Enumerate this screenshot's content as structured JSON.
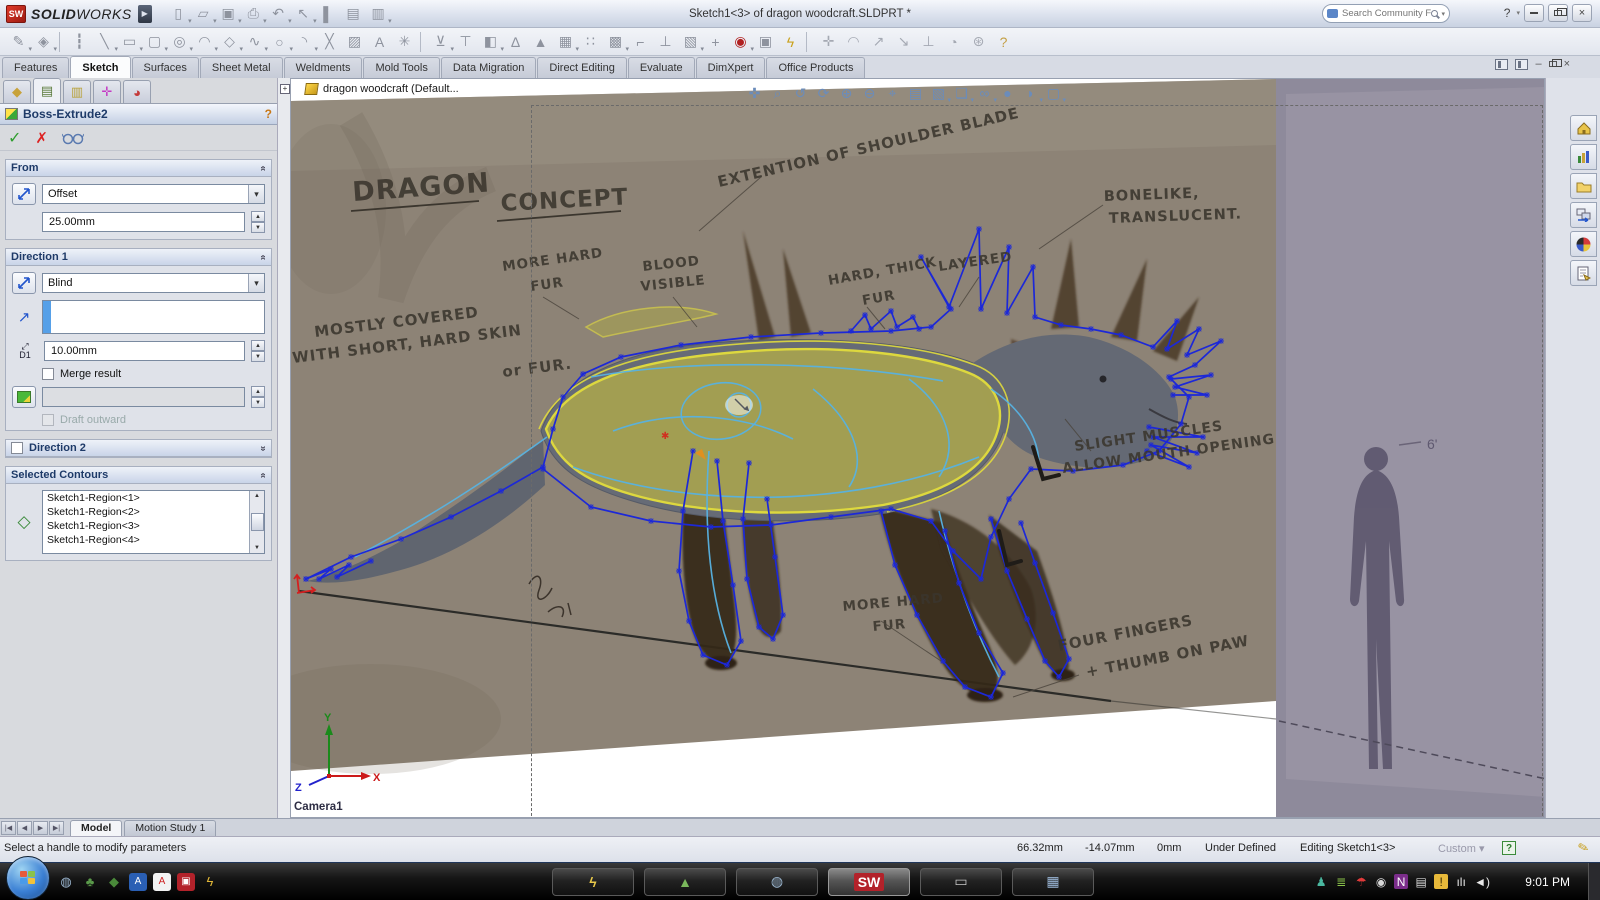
{
  "titlebar": {
    "brand_solid": "SOLID",
    "brand_works": "WORKS",
    "title": "Sketch1<3> of dragon woodcraft.SLDPRT *",
    "search_placeholder": "Search Community Forum",
    "help": "?"
  },
  "std_icons": [
    {
      "g": "▯",
      "dd": 1
    },
    {
      "g": "▱",
      "dd": 1
    },
    {
      "g": "▣",
      "dd": 1
    },
    {
      "g": "⎙",
      "dd": 1
    },
    {
      "g": "↶",
      "dd": 1
    },
    {
      "g": "↖",
      "dd": 1
    },
    {
      "g": "▌"
    },
    {
      "g": "▤"
    },
    {
      "g": "▥",
      "dd": 1
    }
  ],
  "sketch_icons": [
    {
      "g": "✎",
      "dd": 1
    },
    {
      "g": "◈",
      "dd": 1
    },
    {
      "sep": 1
    },
    {
      "g": "┇"
    },
    {
      "g": "╲",
      "dd": 1
    },
    {
      "g": "▭",
      "dd": 1
    },
    {
      "g": "▢",
      "dd": 1
    },
    {
      "g": "◎",
      "dd": 1
    },
    {
      "g": "◠",
      "dd": 1
    },
    {
      "g": "◇",
      "dd": 1
    },
    {
      "g": "∿",
      "dd": 1
    },
    {
      "g": "○",
      "dd": 1
    },
    {
      "g": "◝",
      "dd": 1
    },
    {
      "g": "╳"
    },
    {
      "g": "▨"
    },
    {
      "g": "A"
    },
    {
      "g": "✳"
    },
    {
      "sep": 1
    },
    {
      "g": "⊻",
      "dd": 1
    },
    {
      "g": "⊤"
    },
    {
      "g": "◧",
      "dd": 1
    },
    {
      "g": "∆"
    },
    {
      "g": "▲"
    },
    {
      "g": "▦",
      "dd": 1
    },
    {
      "g": "∷"
    },
    {
      "g": "▩",
      "dd": 1
    },
    {
      "g": "⌐"
    },
    {
      "g": "⊥"
    },
    {
      "g": "▧",
      "dd": 1
    },
    {
      "g": "+"
    },
    {
      "g": "◉",
      "c": "#b02020",
      "dd": 1
    },
    {
      "g": "▣"
    },
    {
      "g": "ϟ",
      "c": "#caa21e"
    }
  ],
  "snap_icons": [
    {
      "g": "✛"
    },
    {
      "g": "◠"
    },
    {
      "g": "↗"
    },
    {
      "g": "↘"
    },
    {
      "g": "⊥"
    },
    {
      "g": "◔"
    },
    {
      "g": "⊛"
    },
    {
      "g": "?",
      "c": "#b8860b"
    }
  ],
  "ribbon_tabs": [
    {
      "label": "Features"
    },
    {
      "label": "Sketch",
      "active": true
    },
    {
      "label": "Surfaces"
    },
    {
      "label": "Sheet Metal"
    },
    {
      "label": "Weldments"
    },
    {
      "label": "Mold Tools"
    },
    {
      "label": "Data Migration"
    },
    {
      "label": "Direct Editing"
    },
    {
      "label": "Evaluate"
    },
    {
      "label": "DimXpert"
    },
    {
      "label": "Office Products"
    }
  ],
  "pm_tabs": [
    {
      "g": "◆",
      "c": "#c8a23a"
    },
    {
      "g": "▤",
      "c": "#5a7a3a",
      "active": true
    },
    {
      "g": "▥",
      "c": "#b8a23a"
    },
    {
      "g": "✛",
      "c": "#c43ac4"
    },
    {
      "g": "◕",
      "c": "#c43a3a"
    }
  ],
  "pm": {
    "title": "Boss-Extrude2",
    "help": "?",
    "from": {
      "title": "From",
      "value": "Offset",
      "offset": "25.00mm"
    },
    "dir1": {
      "title": "Direction 1",
      "value": "Blind",
      "depth": "10.00mm",
      "d1": "D1",
      "merge_label": "Merge result",
      "draft_outward_label": "Draft outward"
    },
    "dir2": {
      "title": "Direction 2"
    },
    "contours": {
      "title": "Selected Contours",
      "items": [
        "Sketch1-Region<1>",
        "Sketch1-Region<2>",
        "Sketch1-Region<3>",
        "Sketch1-Region<4>"
      ]
    }
  },
  "viewport": {
    "doc": "dragon woodcraft  (Default...",
    "camera": "Camera1",
    "height_label": "6'",
    "hud": [
      {
        "g": "✜"
      },
      {
        "g": "⌕"
      },
      {
        "g": "↺"
      },
      {
        "g": "⟳"
      },
      {
        "g": "⊕"
      },
      {
        "g": "⊖"
      },
      {
        "g": "⌖"
      },
      {
        "g": "▤"
      },
      {
        "g": "▧",
        "dd": 1
      },
      {
        "g": "❏",
        "dd": 1
      },
      {
        "g": "∞",
        "dd": 1
      },
      {
        "g": "●"
      },
      {
        "g": "◗",
        "dd": 1
      },
      {
        "g": "▢",
        "dd": 1
      }
    ],
    "ann": {
      "t1": "DRAGON",
      "t2": "CONCEPT",
      "shoulder": "EXTENTION OF SHOULDER BLADE",
      "bone1": "BONELIKE,",
      "bone2": "TRANSLUCENT.",
      "fur1a": "MORE HARD",
      "fur1b": "FUR",
      "blood1": "BLOOD",
      "blood2": "VISIBLE",
      "hard1": "HARD, THICK",
      "hard2": "FUR",
      "layered": "LAYERED",
      "cover1": "MOSTLY COVERED",
      "cover2": "WITH SHORT, HARD SKIN",
      "cover3": "or FUR.",
      "muscle1": "SLIGHT MUSCLES",
      "muscle2": "ALLOW MOUTH OPENING",
      "fur2a": "MORE HARD",
      "fur2b": "FUR",
      "paw1": "FOUR FINGERS",
      "paw2": "+ THUMB ON PAW",
      "axis_x": "X",
      "axis_y": "Y",
      "axis_z": "Z"
    }
  },
  "bottom_tabs": [
    {
      "label": "Model",
      "active": true
    },
    {
      "label": "Motion Study 1"
    }
  ],
  "status": {
    "message": "Select a handle to modify parameters",
    "x": "66.32mm",
    "y": "-14.07mm",
    "z": "0mm",
    "state": "Under Defined",
    "editing": "Editing Sketch1<3>",
    "units": "Custom"
  },
  "taskbar": {
    "time": "9:01 PM",
    "quick": [
      {
        "g": "◍",
        "c": "#9db8d2"
      },
      {
        "g": "♣",
        "c": "#5a9a4a"
      },
      {
        "g": "◆",
        "c": "#4a8a3a"
      },
      {
        "g": "A",
        "c": "#fff",
        "bg": "#2a5fb4"
      },
      {
        "g": "A",
        "c": "#c22",
        "bg": "#f2f2f2"
      },
      {
        "g": "▣",
        "c": "#fff",
        "bg": "#b3222a"
      },
      {
        "g": "ϟ",
        "c": "#e2b838"
      }
    ],
    "buttons": [
      {
        "g": "ϟ",
        "c": "#e8c84a"
      },
      {
        "g": "▲",
        "c": "#7ab85c"
      },
      {
        "g": "◍",
        "c": "#9db8d2"
      },
      {
        "g": "SW",
        "c": "#fff",
        "bg": "#b3222a",
        "active": true
      },
      {
        "g": "▭",
        "c": "#c8c8c8"
      },
      {
        "g": "▦",
        "c": "#9cb8d8"
      }
    ],
    "tray": [
      {
        "g": "♟",
        "c": "#4ab8a0"
      },
      {
        "g": "≣",
        "c": "#8ac24a"
      },
      {
        "g": "☂",
        "c": "#e03a3a"
      },
      {
        "g": "◉",
        "c": "#d8d8d8"
      },
      {
        "g": "N",
        "c": "#fff",
        "bg": "#7b2d8b"
      },
      {
        "g": "▤",
        "c": "#d8d8d8"
      },
      {
        "g": "!",
        "c": "#3a2a00",
        "bg": "#e8b93a"
      },
      {
        "g": "ılı",
        "c": "#e8e8e8"
      },
      {
        "g": "◄)",
        "c": "#e8e8e8"
      }
    ]
  }
}
